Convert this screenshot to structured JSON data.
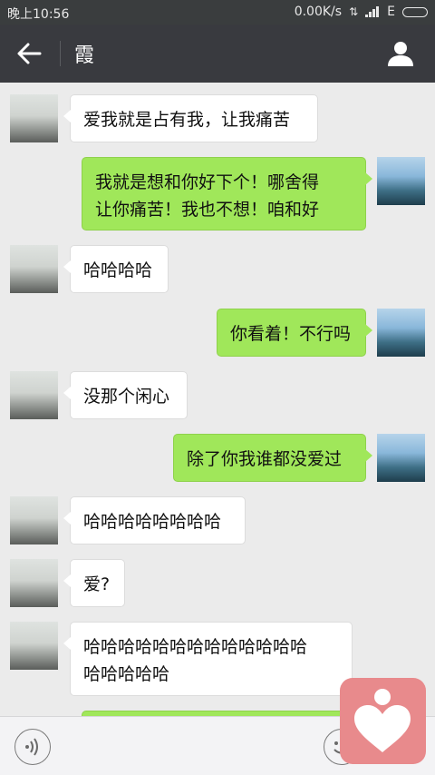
{
  "status_bar": {
    "time": "晚上10:56",
    "speed": "0.00K/s",
    "network_type": "E"
  },
  "nav": {
    "title": "霞",
    "back_icon": "arrow-left-icon",
    "profile_icon": "person-icon"
  },
  "messages": [
    {
      "side": "recv",
      "text": "爱我就是占有我，让我痛苦"
    },
    {
      "side": "sent",
      "lines": [
        "我就是想和你好下个！哪舍得",
        "让你痛苦！我也不想！咱和好"
      ]
    },
    {
      "side": "recv",
      "text": "哈哈哈哈"
    },
    {
      "side": "sent",
      "text": "你看着！不行吗"
    },
    {
      "side": "recv",
      "text": "没那个闲心"
    },
    {
      "side": "sent",
      "text": "除了你我谁都没爱过"
    },
    {
      "side": "recv",
      "text": "哈哈哈哈哈哈哈哈"
    },
    {
      "side": "recv",
      "text": "爱?"
    },
    {
      "side": "recv",
      "lines": [
        "哈哈哈哈哈哈哈哈哈哈哈哈哈",
        "哈哈哈哈哈"
      ]
    }
  ],
  "input_bar": {
    "voice_icon": "voice-icon",
    "emoji_icon": "emoji-icon"
  },
  "floating_widget_icon": "heart-icon",
  "colors": {
    "sent_bubble": "#a0e75a",
    "nav_bg": "#393a3f",
    "chat_bg": "#ebebeb"
  }
}
